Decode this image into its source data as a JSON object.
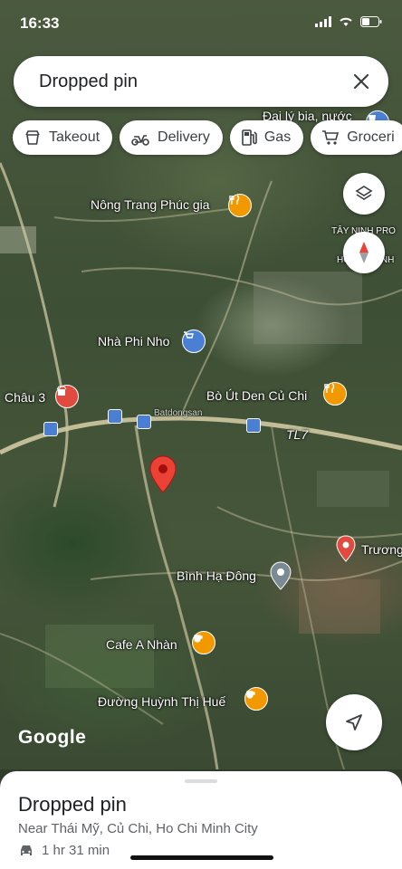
{
  "status_bar": {
    "time": "16:33"
  },
  "search": {
    "title": "Dropped pin",
    "close_icon": "close-icon"
  },
  "chips": [
    {
      "label": "Takeout",
      "icon": "takeout-icon"
    },
    {
      "label": "Delivery",
      "icon": "delivery-icon"
    },
    {
      "label": "Gas",
      "icon": "gas-icon"
    },
    {
      "label": "Groceri",
      "icon": "grocery-icon"
    }
  ],
  "map": {
    "places": {
      "dai_ly": "Đại lý bia, nước",
      "nong_trang": "Nông Trang Phúc gia",
      "tay_ninh": "TÂY NINH PRO",
      "ho_chi_minh": "HỒ CHÍ MINH",
      "nha_phi_nho": "Nhà Phi Nho",
      "chau3": "Châu 3",
      "bo_ut": "Bò Út Den Củ Chi",
      "road": "TL7",
      "truong": "Trương",
      "binh_ha_dong": "Bình Hạ Đông",
      "cafe": "Cafe A Nhàn",
      "duong": "Đường Huỳnh Thị Huế",
      "watermark": "Batdongsan"
    },
    "brand": "Google",
    "colors": {
      "pin": "#ea4335",
      "food": "#f29900",
      "shop": "#4a7fd4",
      "red_poi": "#e04a3f",
      "landmark": "#7b8a93"
    }
  },
  "sheet": {
    "title": "Dropped pin",
    "subtitle": "Near Thái Mỹ, Củ Chi, Ho Chi Minh City",
    "eta": "1 hr 31 min"
  }
}
